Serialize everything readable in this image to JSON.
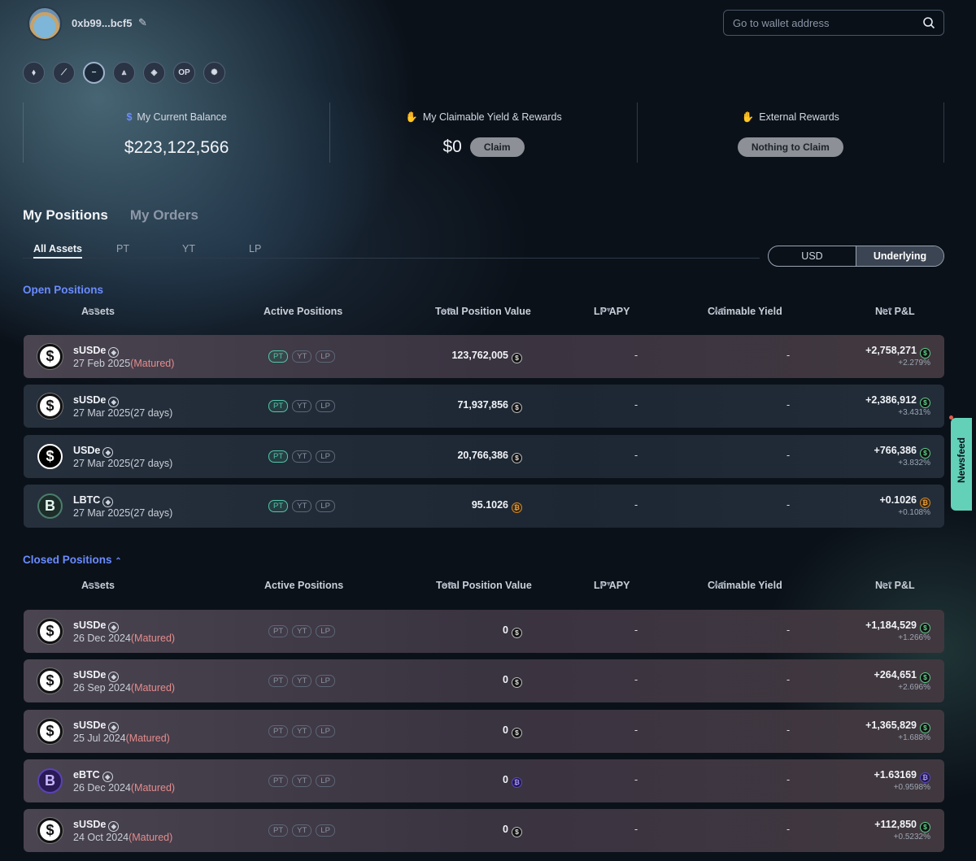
{
  "header": {
    "wallet": "0xb99...bcf5",
    "search_placeholder": "Go to wallet address"
  },
  "chains": [
    {
      "name": "ethereum",
      "glyph": "⬧"
    },
    {
      "name": "arbitrum",
      "glyph": "⟋"
    },
    {
      "name": "mantle",
      "glyph": "−"
    },
    {
      "name": "chain-4",
      "glyph": "⩓"
    },
    {
      "name": "bnb",
      "glyph": "◈"
    },
    {
      "name": "optimism",
      "glyph": "OP"
    },
    {
      "name": "chain-7",
      "glyph": "✺"
    }
  ],
  "summary": {
    "balance_title": "My Current Balance",
    "balance_value": "$223,122,566",
    "claimable_title": "My Claimable Yield & Rewards",
    "claimable_value": "$0",
    "claim_label": "Claim",
    "external_title": "External Rewards",
    "nothing_label": "Nothing to Claim"
  },
  "tabs": {
    "positions": "My Positions",
    "orders": "My Orders",
    "sub": [
      "All Assets",
      "PT",
      "YT",
      "LP"
    ],
    "usd": "USD",
    "underlying": "Underlying"
  },
  "columns": {
    "assets": "Assets",
    "active": "Active Positions",
    "value": "Total Position Value",
    "apy": "LP APY",
    "yield": "Claimable Yield",
    "pnl": "Net P&L"
  },
  "open_title": "Open Positions",
  "closed_title": "Closed Positions",
  "open_positions": [
    {
      "asset": "sUSDe",
      "date": "27 Feb 2025",
      "status": "(Matured)",
      "value": "123,762,005",
      "apy": "-",
      "yield": "-",
      "pnl": "+2,758,271",
      "pct": "+2.279%"
    },
    {
      "asset": "sUSDe",
      "date": "27 Mar 2025",
      "status": "(27 days)",
      "value": "71,937,856",
      "apy": "-",
      "yield": "-",
      "pnl": "+2,386,912",
      "pct": "+3.431%"
    },
    {
      "asset": "USDe",
      "date": "27 Mar 2025",
      "status": "(27 days)",
      "value": "20,766,386",
      "apy": "-",
      "yield": "-",
      "pnl": "+766,386",
      "pct": "+3.832%"
    },
    {
      "asset": "LBTC",
      "date": "27 Mar 2025",
      "status": "(27 days)",
      "value": "95.1026",
      "apy": "-",
      "yield": "-",
      "pnl": "+0.1026",
      "pct": "+0.108%"
    }
  ],
  "closed_positions": [
    {
      "asset": "sUSDe",
      "date": "26 Dec 2024",
      "status": "(Matured)",
      "value": "0",
      "apy": "-",
      "yield": "-",
      "pnl": "+1,184,529",
      "pct": "+1.266%"
    },
    {
      "asset": "sUSDe",
      "date": "26 Sep 2024",
      "status": "(Matured)",
      "value": "0",
      "apy": "-",
      "yield": "-",
      "pnl": "+264,651",
      "pct": "+2.696%"
    },
    {
      "asset": "sUSDe",
      "date": "25 Jul 2024",
      "status": "(Matured)",
      "value": "0",
      "apy": "-",
      "yield": "-",
      "pnl": "+1,365,829",
      "pct": "+1.688%"
    },
    {
      "asset": "eBTC",
      "date": "26 Dec 2024",
      "status": "(Matured)",
      "value": "0",
      "apy": "-",
      "yield": "-",
      "pnl": "+1.63169",
      "pct": "+0.9598%"
    },
    {
      "asset": "sUSDe",
      "date": "24 Oct 2024",
      "status": "(Matured)",
      "value": "0",
      "apy": "-",
      "yield": "-",
      "pnl": "+112,850",
      "pct": "+0.5232%"
    }
  ],
  "pills": [
    "PT",
    "YT",
    "LP"
  ],
  "newsfeed": "Newsfeed",
  "colors": {
    "accent": "#6a8cff",
    "matured": "#e48c8c",
    "teal": "#53c6a8"
  }
}
